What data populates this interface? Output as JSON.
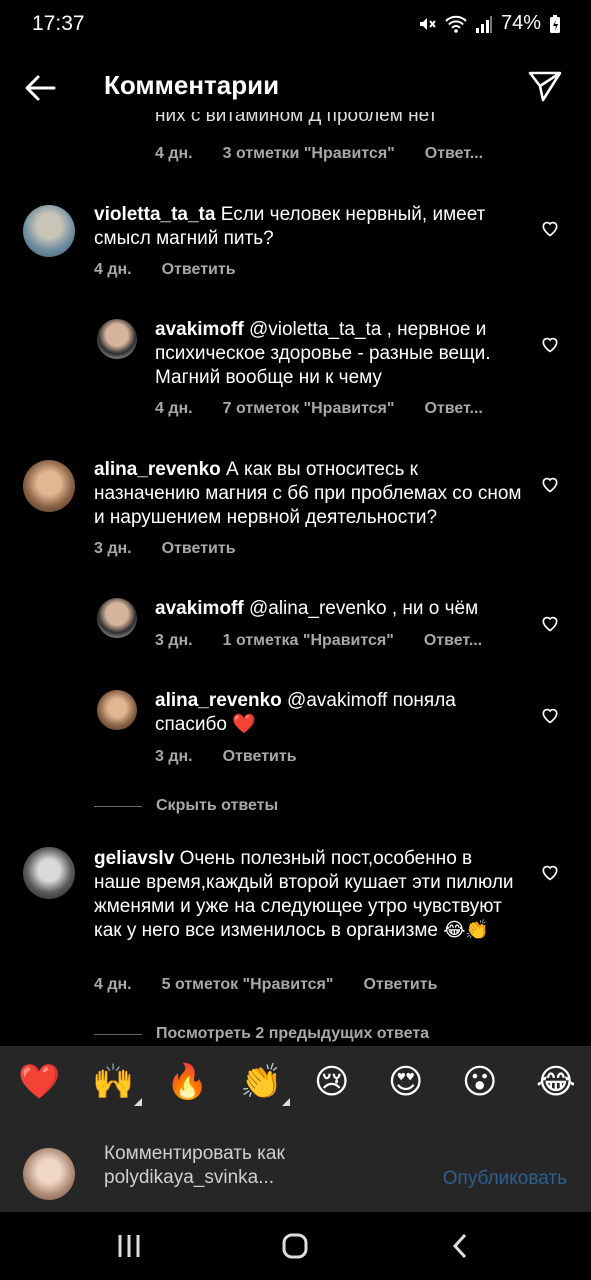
{
  "status": {
    "time": "17:37",
    "battery": "74%"
  },
  "header": {
    "title": "Комментарии",
    "back_icon": "arrow-left-icon",
    "send_icon": "paper-plane-icon"
  },
  "partial_comment": {
    "text": "них с витамином Д проблем нет",
    "meta": {
      "time": "4 дн.",
      "likes": "3 отметки \"Нравится\"",
      "reply": "Ответ..."
    }
  },
  "comments": [
    {
      "username": "violetta_ta_ta",
      "text": "Если человек нервный, имеет смысл магний пить?",
      "time": "4 дн.",
      "reply": "Ответить"
    },
    {
      "username": "avakimoff",
      "mention": "@violetta_ta_ta",
      "text": ", нервное и психическое здоровье - разные вещи. Магний вообще ни к чему",
      "time": "4 дн.",
      "likes": "7 отметок \"Нравится\"",
      "reply": "Ответ..."
    },
    {
      "username": "alina_revenko",
      "text": "А как вы относитесь к назначению магния с б6 при проблемах со сном и нарушением нервной деятельности?",
      "time": "3 дн.",
      "reply": "Ответить"
    },
    {
      "username": "avakimoff",
      "mention": "@alina_revenko",
      "text": ", ни о чём",
      "time": "3 дн.",
      "likes": "1 отметка \"Нравится\"",
      "reply": "Ответ..."
    },
    {
      "username": "alina_revenko",
      "mention": "@avakimoff",
      "text": "поняла спасибо ❤️",
      "time": "3 дн.",
      "reply": "Ответить"
    },
    {
      "username": "geliavslv",
      "text": "Очень полезный пост,особенно в наше время,каждый второй кушает эти пилюли жменями и уже на следующее утро чувствуют как у него все изменилось в организме 😂👏",
      "time": "4 дн.",
      "likes": "5 отметок \"Нравится\"",
      "reply": "Ответить"
    }
  ],
  "hide_replies": "Скрыть ответы",
  "view_replies": "Посмотреть 2 предыдущих ответа",
  "reactions": [
    "❤️",
    "🙌",
    "🔥",
    "👏",
    "😢",
    "😍",
    "😮",
    "😂"
  ],
  "composer": {
    "placeholder_line1": "Комментировать как",
    "placeholder_line2": "polydikaya_svinka...",
    "publish": "Опубликовать"
  }
}
